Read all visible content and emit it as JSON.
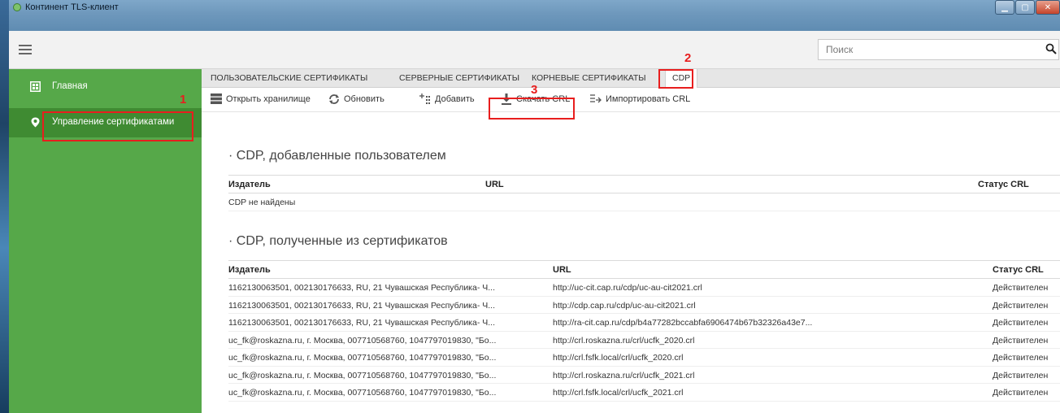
{
  "window": {
    "title": "Континент TLS-клиент",
    "controls": [
      "minimize",
      "maximize",
      "close"
    ]
  },
  "header": {
    "menu_icon": "hamburger-icon",
    "search": {
      "placeholder": "Поиск",
      "value": ""
    }
  },
  "sidebar": {
    "items": [
      {
        "label": "Главная",
        "icon": "home-icon",
        "selected": false
      },
      {
        "label": "Управление сертификатами",
        "icon": "location-pin-icon",
        "selected": true
      }
    ]
  },
  "tabs": [
    {
      "label": "ПОЛЬЗОВАТЕЛЬСКИЕ СЕРТИФИКАТЫ",
      "active": false
    },
    {
      "label": "СЕРВЕРНЫЕ СЕРТИФИКАТЫ",
      "active": false
    },
    {
      "label": "КОРНЕВЫЕ СЕРТИФИКАТЫ",
      "active": false
    },
    {
      "label": "CDP",
      "active": true
    }
  ],
  "toolbar": {
    "open_storage": "Открыть хранилище",
    "refresh": "Обновить",
    "add": "Добавить",
    "download_crl": "Скачать CRL",
    "import_crl": "Импортировать CRL"
  },
  "annotations": {
    "step1": "1",
    "step2": "2",
    "step3": "3"
  },
  "user_cdp": {
    "title": "CDP, добавленные пользователем",
    "columns": {
      "issuer": "Издатель",
      "url": "URL",
      "status": "Статус CRL"
    },
    "empty_text": "CDP не найдены"
  },
  "cert_cdp": {
    "title": "CDP, полученные из сертификатов",
    "columns": {
      "issuer": "Издатель",
      "url": "URL",
      "status": "Статус CRL"
    },
    "rows": [
      {
        "issuer": "1162130063501, 002130176633, RU, 21 Чувашская Республика- Ч...",
        "url": "http://uc-cit.cap.ru/cdp/uc-au-cit2021.crl",
        "status": "Действителен"
      },
      {
        "issuer": "1162130063501, 002130176633, RU, 21 Чувашская Республика- Ч...",
        "url": "http://cdp.cap.ru/cdp/uc-au-cit2021.crl",
        "status": "Действителен"
      },
      {
        "issuer": "1162130063501, 002130176633, RU, 21 Чувашская Республика- Ч...",
        "url": "http://ra-cit.cap.ru/cdp/b4a77282bccabfa6906474b67b32326a43e7...",
        "status": "Действителен"
      },
      {
        "issuer": "uc_fk@roskazna.ru, г. Москва, 007710568760, 1047797019830, \"Бо...",
        "url": "http://crl.roskazna.ru/crl/ucfk_2020.crl",
        "status": "Действителен"
      },
      {
        "issuer": "uc_fk@roskazna.ru, г. Москва, 007710568760, 1047797019830, \"Бо...",
        "url": "http://crl.fsfk.local/crl/ucfk_2020.crl",
        "status": "Действителен"
      },
      {
        "issuer": "uc_fk@roskazna.ru, г. Москва, 007710568760, 1047797019830, \"Бо...",
        "url": "http://crl.roskazna.ru/crl/ucfk_2021.crl",
        "status": "Действителен"
      },
      {
        "issuer": "uc_fk@roskazna.ru, г. Москва, 007710568760, 1047797019830, \"Бо...",
        "url": "http://crl.fsfk.local/crl/ucfk_2021.crl",
        "status": "Действителен"
      }
    ]
  },
  "colors": {
    "sidebar": "#56a849",
    "sidebar_selected": "#3f8b32",
    "annotation": "#e81e1e"
  }
}
